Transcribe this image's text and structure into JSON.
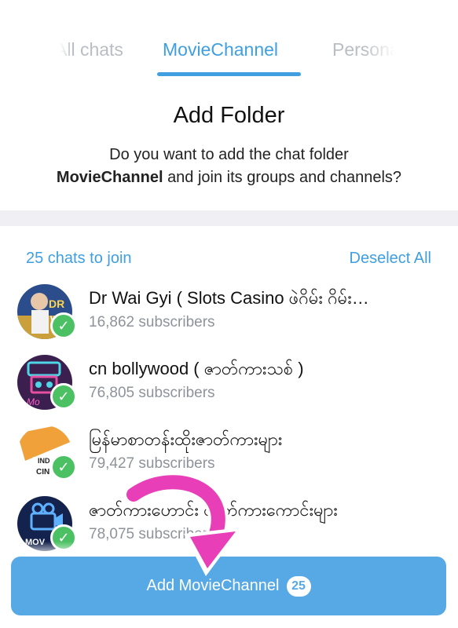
{
  "tabs": [
    {
      "label": "All chats"
    },
    {
      "label": "MovieChannel"
    },
    {
      "label": "Personal"
    }
  ],
  "dialog": {
    "title": "Add Folder",
    "desc_prefix": "Do you want to add the chat folder",
    "folder_name": "MovieChannel",
    "desc_suffix": "and join its groups and channels?"
  },
  "list": {
    "count_label": "25 chats to join",
    "deselect_label": "Deselect All",
    "chats": [
      {
        "name": "Dr Wai Gyi ( Slots Casino ဖဲဂိမ်း ဂိမ်း…",
        "subscribers": "16,862 subscribers",
        "avatar_color": "#2b4d8c"
      },
      {
        "name": "cn bollywood ( ဇာတ်ကားသစ် )",
        "subscribers": "76,805 subscribers",
        "avatar_color": "#3a1f4f"
      },
      {
        "name": "မြန်မာစာတန်းထိုးဇာတ်ကားများ",
        "subscribers": "79,427 subscribers",
        "avatar_color": "#f1a13a"
      },
      {
        "name": "ဇာတ်ကားဟောင်း ဇာတ်ကားကောင်းများ",
        "subscribers": "78,075 subscribers",
        "avatar_color": "#14234d"
      }
    ]
  },
  "button": {
    "label": "Add MovieChannel",
    "badge": "25"
  },
  "colors": {
    "accent": "#3f9fe0",
    "button": "#57a9e6",
    "check": "#4cc163",
    "arrow": "#e83fb8"
  }
}
